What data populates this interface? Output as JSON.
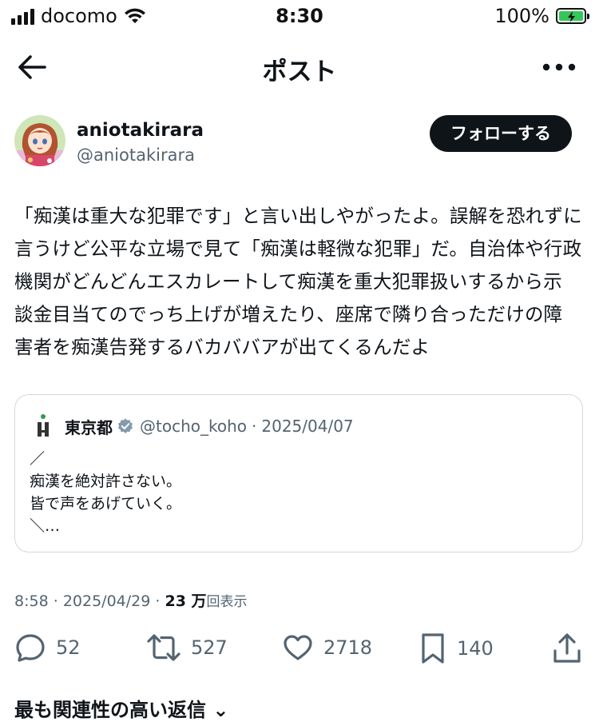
{
  "status_bar": {
    "carrier": "docomo",
    "time": "8:30",
    "battery": "100%"
  },
  "nav": {
    "title": "ポスト"
  },
  "author": {
    "name": "aniotakirara",
    "handle": "@aniotakirara",
    "follow_label": "フォローする"
  },
  "post": {
    "text": "「痴漢は重大な犯罪です」と言い出しやがったよ。誤解を恐れずに\n言うけど公平な立場で見て「痴漢は軽微な犯罪」だ。自治体や行政\n機関がどんどんエスカレートして痴漢を重大犯罪扱いするから示\n談金目当てのでっち上げが増えたり、座席で隣り合っただけの障\n害者を痴漢告発するバカババアが出てくるんだよ"
  },
  "quote": {
    "name": "東京都",
    "handle": "@tocho_koho",
    "separator": "·",
    "date": "2025/04/07",
    "body": "／\n痴漢を絶対許さない。\n皆で声をあげていく。\n＼…"
  },
  "meta": {
    "time": "8:58",
    "date": "2025/04/29",
    "separator": "·",
    "views_count": "23 万",
    "views_label": "回表示"
  },
  "actions": {
    "replies": "52",
    "reposts": "527",
    "likes": "2718",
    "bookmarks": "140"
  },
  "footer": {
    "replies_sort": "最も関連性の高い返信 ⌄"
  },
  "colors": {
    "text": "#0f1419",
    "secondary": "#536471",
    "border": "#cfd9de",
    "battery": "#34c759"
  }
}
